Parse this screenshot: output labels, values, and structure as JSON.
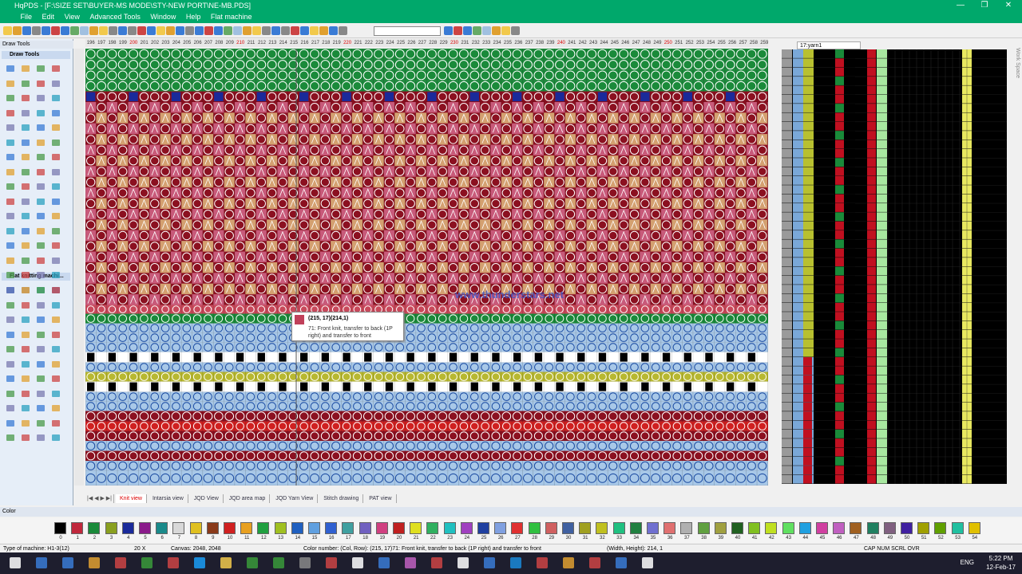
{
  "window": {
    "title": "HqPDS - [F:\\SIZE SET\\BUYER-MS MODE\\STY-NEW PORT\\NE-MB.PDS]",
    "minimize": "—",
    "maximize": "❐",
    "close": "✕"
  },
  "menu": [
    "File",
    "Edit",
    "View",
    "Advanced Tools",
    "Window",
    "Help",
    "Flat machine"
  ],
  "panels": {
    "draw_tools_header": "Draw Tools",
    "draw_tools_title": "Draw Tools",
    "flat_knitting_title": "Flat knitting machi..."
  },
  "ruler": {
    "columns": [
      "196",
      "197",
      "198",
      "199",
      "200",
      "201",
      "202",
      "203",
      "204",
      "205",
      "206",
      "207",
      "208",
      "209",
      "210",
      "211",
      "212",
      "213",
      "214",
      "215",
      "216",
      "217",
      "218",
      "219",
      "220",
      "221",
      "222",
      "223",
      "224",
      "225",
      "226",
      "227",
      "228",
      "229",
      "230",
      "231",
      "232",
      "233",
      "234",
      "235",
      "236",
      "237",
      "238",
      "239",
      "240",
      "241",
      "242",
      "243",
      "244",
      "245",
      "246",
      "247",
      "248",
      "249",
      "250",
      "251",
      "252",
      "253",
      "254",
      "255",
      "256",
      "257",
      "258",
      "259"
    ]
  },
  "tooltip": {
    "title": "(215, 17)(214,1)",
    "description": "71: Front knit, transfer to back (1P right) and transfer to front"
  },
  "watermark": "www.thunderstars.net",
  "tabs": [
    "Knit view",
    "Intarsia view",
    "JQD View",
    "JQD area map",
    "JQD Yarn View",
    "Stitch drawing",
    "PAT view"
  ],
  "right_panel": {
    "yarn_select": "17:yarn1",
    "side_label": "Work Space"
  },
  "color_bar_label": "Color",
  "palette": {
    "numbers": [
      "0",
      "1",
      "2",
      "3",
      "4",
      "5",
      "6",
      "7",
      "8",
      "9",
      "10",
      "11",
      "12",
      "13",
      "14",
      "15",
      "16",
      "17",
      "18",
      "19",
      "20",
      "21",
      "22",
      "23",
      "24",
      "25",
      "26",
      "27",
      "28",
      "29",
      "30",
      "31",
      "32",
      "33",
      "34",
      "35",
      "36",
      "37",
      "38",
      "39",
      "40",
      "41",
      "42",
      "43",
      "44",
      "45",
      "46",
      "47",
      "48",
      "49",
      "50",
      "51",
      "52",
      "53",
      "54"
    ],
    "colors": [
      "#000000",
      "#c0283c",
      "#1a8a3a",
      "#8aa020",
      "#1a2a9a",
      "#8a1a8a",
      "#1a8a8a",
      "#d8d8d8",
      "#e0c020",
      "#8a3a1a",
      "#d02020",
      "#e8a020",
      "#20a040",
      "#a0c020",
      "#2060c0",
      "#60a0e0",
      "#3060d0",
      "#40a0a0",
      "#7060c0",
      "#d04080",
      "#c02020",
      "#e0e020",
      "#30b060",
      "#20c0c0",
      "#a040c0",
      "#2040a0",
      "#80a0e0",
      "#e03030",
      "#30c040",
      "#d06060",
      "#4060a0",
      "#a0a020",
      "#c0c020",
      "#20c080",
      "#208040",
      "#7070d0",
      "#e07070",
      "#b0b0b0",
      "#60a040",
      "#a0a040",
      "#206020",
      "#80c020",
      "#c0e020",
      "#60e060",
      "#20a0e0",
      "#d040a0",
      "#c060c0",
      "#a06020",
      "#208060",
      "#806080",
      "#4020a0",
      "#a0a000",
      "#60a000",
      "#20c0a0",
      "#e0c000"
    ]
  },
  "status": {
    "machine_type": "Type of machine: H1-3(12)",
    "zoom": "20 X",
    "canvas": "Canvas: 2048, 2048",
    "cell_info": "Color number: (Col, Row): (215, 17)71: Front knit, transfer to back (1P right) and transfer to front",
    "size": "(Width, Height): 214, 1",
    "flags": "CAP NUM SCRL OVR"
  },
  "taskbar": {
    "language": "ENG",
    "time": "5:22 PM",
    "date": "12-Feb-17"
  }
}
